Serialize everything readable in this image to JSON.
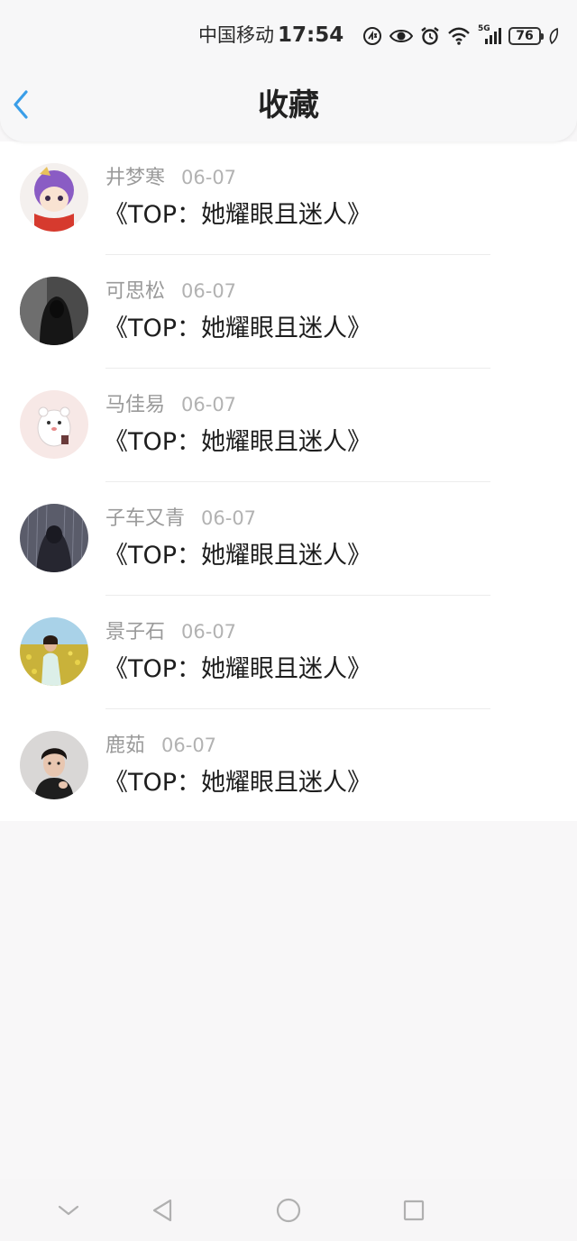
{
  "status_bar": {
    "carrier": "中国移动",
    "time": "17:54",
    "network": "5G",
    "battery": "76",
    "icons": [
      "hd-voice-icon",
      "eye-icon",
      "alarm-icon",
      "wifi-icon",
      "signal-icon",
      "battery-icon",
      "leaf-icon"
    ]
  },
  "nav": {
    "title": "收藏",
    "back_icon": "chevron-left-icon",
    "accent_color": "#3a9ee8"
  },
  "favorites": [
    {
      "username": "井梦寒",
      "date": "06-07",
      "title": "《TOP：她耀眼且迷人》",
      "avatar": "anime-character-avatar"
    },
    {
      "username": "可思松",
      "date": "06-07",
      "title": "《TOP：她耀眼且迷人》",
      "avatar": "hooded-figure-avatar"
    },
    {
      "username": "马佳易",
      "date": "06-07",
      "title": "《TOP：她耀眼且迷人》",
      "avatar": "cartoon-panda-avatar"
    },
    {
      "username": "子车又青",
      "date": "06-07",
      "title": "《TOP：她耀眼且迷人》",
      "avatar": "rain-figure-avatar"
    },
    {
      "username": "景子石",
      "date": "06-07",
      "title": "《TOP：她耀眼且迷人》",
      "avatar": "flower-field-portrait-avatar"
    },
    {
      "username": "鹿茹",
      "date": "06-07",
      "title": "《TOP：她耀眼且迷人》",
      "avatar": "man-portrait-avatar"
    }
  ],
  "system_nav": [
    "collapse-icon",
    "back-triangle-icon",
    "home-circle-icon",
    "recents-square-icon"
  ]
}
